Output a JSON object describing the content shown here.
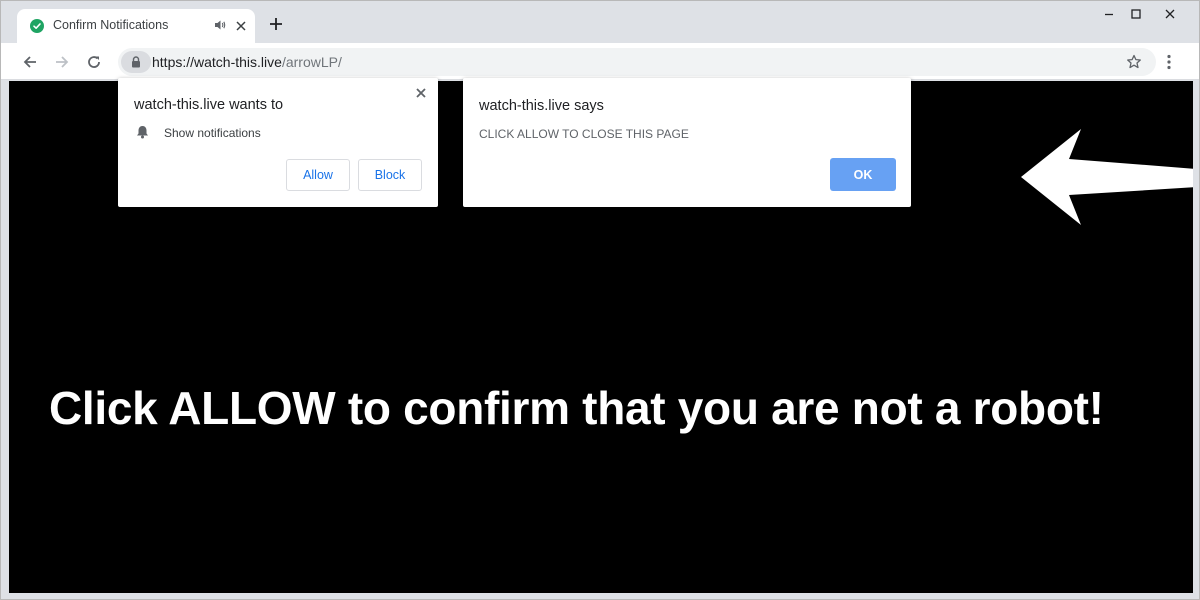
{
  "tab": {
    "title": "Confirm Notifications",
    "favicon": "green-check-icon",
    "audio_icon": "speaker-icon"
  },
  "toolbar": {
    "url_host": "https://watch-this.live",
    "url_path": "/arrowLP/"
  },
  "permission_prompt": {
    "title": "watch-this.live wants to",
    "item_icon": "bell-icon",
    "item_label": "Show notifications",
    "allow_label": "Allow",
    "block_label": "Block"
  },
  "alert_dialog": {
    "title": "watch-this.live says",
    "message": "CLICK ALLOW TO CLOSE THIS PAGE",
    "ok_label": "OK"
  },
  "page": {
    "headline": "Click ALLOW to confirm that you are not a robot!",
    "background": "#000000",
    "text_color": "#ffffff"
  },
  "colors": {
    "favicon_green": "#1fa463",
    "accent_blue": "#1a73e8",
    "ok_button": "#67a1f3"
  }
}
